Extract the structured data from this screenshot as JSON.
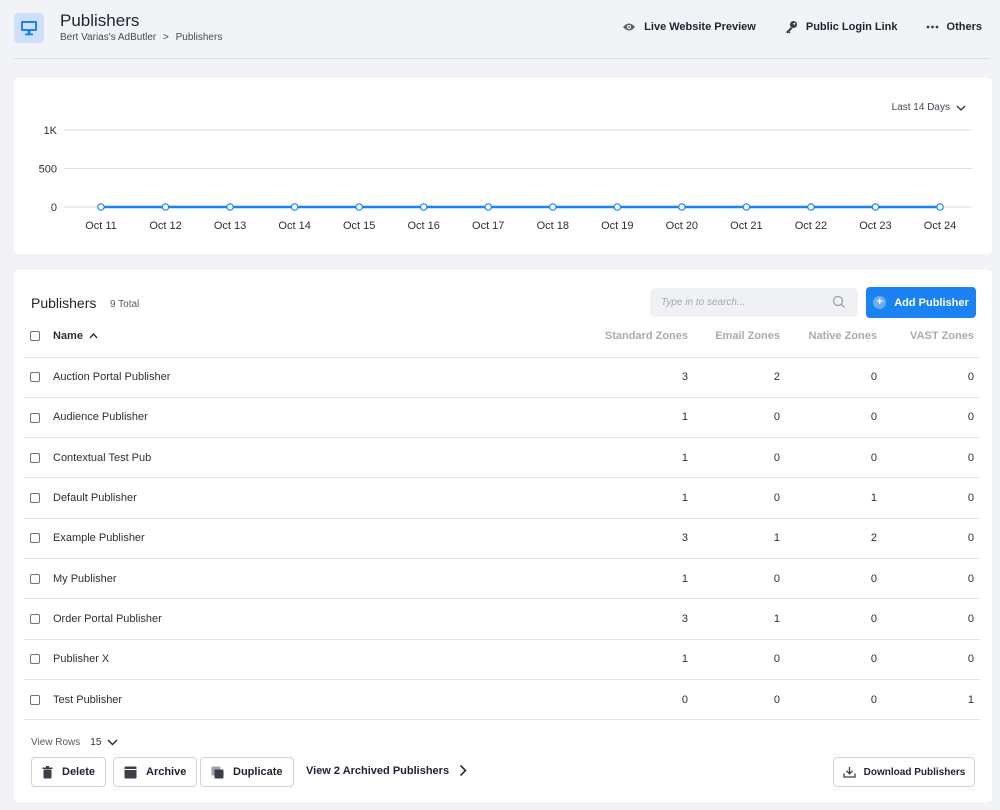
{
  "header": {
    "title": "Publishers",
    "breadcrumb": [
      "Bert Varias's AdButler",
      ">",
      "Publishers"
    ],
    "actions": [
      {
        "label": "Live Website Preview",
        "icon": "eye-icon"
      },
      {
        "label": "Public Login Link",
        "icon": "key-icon"
      },
      {
        "label": "Others",
        "icon": "more-dots-icon"
      }
    ],
    "app_icon": "monitor-icon",
    "accent": "#1a82f2"
  },
  "chart": {
    "range_label": "Last 14 Days"
  },
  "chart_data": {
    "type": "line",
    "x": [
      "Oct 11",
      "Oct 12",
      "Oct 13",
      "Oct 14",
      "Oct 15",
      "Oct 16",
      "Oct 17",
      "Oct 18",
      "Oct 19",
      "Oct 20",
      "Oct 21",
      "Oct 22",
      "Oct 23",
      "Oct 24"
    ],
    "series": [
      {
        "values": [
          0,
          0,
          0,
          0,
          0,
          0,
          0,
          0,
          0,
          0,
          0,
          0,
          0,
          0
        ],
        "color": "#1a82f2"
      }
    ],
    "yticks": [
      "1K",
      "500",
      "0"
    ],
    "ylim": [
      0,
      1000
    ],
    "grid": true
  },
  "table": {
    "title": "Publishers",
    "total": "9 Total",
    "search_placeholder": "Type in to search...",
    "add_label": "Add Publisher",
    "columns": [
      "Name",
      "Standard Zones",
      "Email Zones",
      "Native Zones",
      "VAST Zones"
    ],
    "rows": [
      {
        "name": "Auction Portal Publisher",
        "standard": "3",
        "email": "2",
        "native": "0",
        "vast": "0"
      },
      {
        "name": "Audience Publisher",
        "standard": "1",
        "email": "0",
        "native": "0",
        "vast": "0"
      },
      {
        "name": "Contextual Test Pub",
        "standard": "1",
        "email": "0",
        "native": "0",
        "vast": "0"
      },
      {
        "name": "Default Publisher",
        "standard": "1",
        "email": "0",
        "native": "1",
        "vast": "0"
      },
      {
        "name": "Example Publisher",
        "standard": "3",
        "email": "1",
        "native": "2",
        "vast": "0"
      },
      {
        "name": "My Publisher",
        "standard": "1",
        "email": "0",
        "native": "0",
        "vast": "0"
      },
      {
        "name": "Order Portal Publisher",
        "standard": "3",
        "email": "1",
        "native": "0",
        "vast": "0"
      },
      {
        "name": "Publisher X",
        "standard": "1",
        "email": "0",
        "native": "0",
        "vast": "0"
      },
      {
        "name": "Test Publisher",
        "standard": "0",
        "email": "0",
        "native": "0",
        "vast": "1"
      }
    ]
  },
  "footer": {
    "view_rows_label": "View Rows",
    "view_rows_value": "15",
    "delete_label": "Delete",
    "archive_label": "Archive",
    "duplicate_label": "Duplicate",
    "archived_link": "View 2 Archived Publishers",
    "download_label": "Download Publishers"
  }
}
